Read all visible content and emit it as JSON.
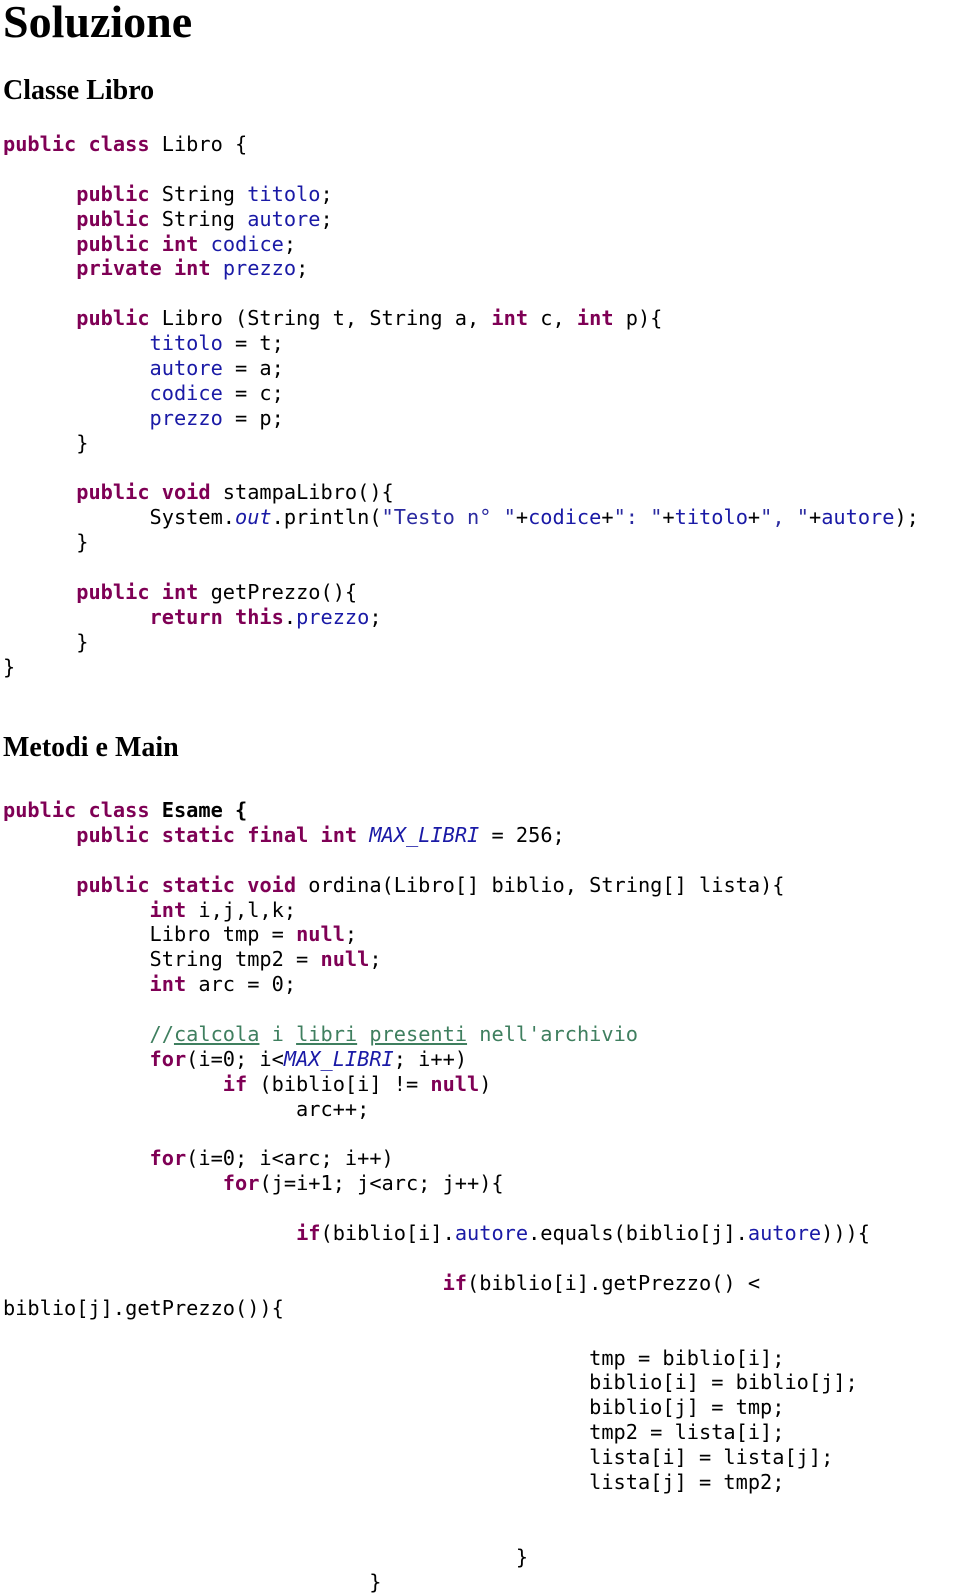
{
  "title": "Soluzione",
  "sections": [
    {
      "heading": "Classe Libro",
      "lines": [
        [
          [
            "kw",
            "public"
          ],
          [
            "t",
            " "
          ],
          [
            "kw",
            "class"
          ],
          [
            "t",
            " Libro {"
          ]
        ],
        [
          [
            "t",
            ""
          ]
        ],
        [
          [
            "t",
            "      "
          ],
          [
            "kw",
            "public"
          ],
          [
            "t",
            " String "
          ],
          [
            "fld",
            "titolo"
          ],
          [
            "t",
            ";"
          ]
        ],
        [
          [
            "t",
            "      "
          ],
          [
            "kw",
            "public"
          ],
          [
            "t",
            " String "
          ],
          [
            "fld",
            "autore"
          ],
          [
            "t",
            ";"
          ]
        ],
        [
          [
            "t",
            "      "
          ],
          [
            "kw",
            "public"
          ],
          [
            "t",
            " "
          ],
          [
            "kw",
            "int"
          ],
          [
            "t",
            " "
          ],
          [
            "fld",
            "codice"
          ],
          [
            "t",
            ";"
          ]
        ],
        [
          [
            "t",
            "      "
          ],
          [
            "kw",
            "private"
          ],
          [
            "t",
            " "
          ],
          [
            "kw",
            "int"
          ],
          [
            "t",
            " "
          ],
          [
            "fld",
            "prezzo"
          ],
          [
            "t",
            ";"
          ]
        ],
        [
          [
            "t",
            ""
          ]
        ],
        [
          [
            "t",
            "      "
          ],
          [
            "kw",
            "public"
          ],
          [
            "t",
            " Libro (String t, String a, "
          ],
          [
            "kw",
            "int"
          ],
          [
            "t",
            " c, "
          ],
          [
            "kw",
            "int"
          ],
          [
            "t",
            " p){"
          ]
        ],
        [
          [
            "t",
            "            "
          ],
          [
            "fld",
            "titolo"
          ],
          [
            "t",
            " = t;"
          ]
        ],
        [
          [
            "t",
            "            "
          ],
          [
            "fld",
            "autore"
          ],
          [
            "t",
            " = a;"
          ]
        ],
        [
          [
            "t",
            "            "
          ],
          [
            "fld",
            "codice"
          ],
          [
            "t",
            " = c;"
          ]
        ],
        [
          [
            "t",
            "            "
          ],
          [
            "fld",
            "prezzo"
          ],
          [
            "t",
            " = p;"
          ]
        ],
        [
          [
            "t",
            "      }"
          ]
        ],
        [
          [
            "t",
            ""
          ]
        ],
        [
          [
            "t",
            "      "
          ],
          [
            "kw",
            "public"
          ],
          [
            "t",
            " "
          ],
          [
            "kw",
            "void"
          ],
          [
            "t",
            " stampaLibro(){"
          ]
        ],
        [
          [
            "t",
            "            System."
          ],
          [
            "sfld",
            "out"
          ],
          [
            "t",
            ".println("
          ],
          [
            "str",
            "\"Testo n° \""
          ],
          [
            "t",
            "+"
          ],
          [
            "fld",
            "codice"
          ],
          [
            "t",
            "+"
          ],
          [
            "str",
            "\": \""
          ],
          [
            "t",
            "+"
          ],
          [
            "fld",
            "titolo"
          ],
          [
            "t",
            "+"
          ],
          [
            "str",
            "\", \""
          ],
          [
            "t",
            "+"
          ],
          [
            "fld",
            "autore"
          ],
          [
            "t",
            ");"
          ]
        ],
        [
          [
            "t",
            "      }"
          ]
        ],
        [
          [
            "t",
            ""
          ]
        ],
        [
          [
            "t",
            "      "
          ],
          [
            "kw",
            "public"
          ],
          [
            "t",
            " "
          ],
          [
            "kw",
            "int"
          ],
          [
            "t",
            " getPrezzo(){"
          ]
        ],
        [
          [
            "t",
            "            "
          ],
          [
            "kw",
            "return"
          ],
          [
            "t",
            " "
          ],
          [
            "kw",
            "this"
          ],
          [
            "t",
            "."
          ],
          [
            "fld",
            "prezzo"
          ],
          [
            "t",
            ";"
          ]
        ],
        [
          [
            "t",
            "      }"
          ]
        ],
        [
          [
            "t",
            "}"
          ]
        ]
      ]
    },
    {
      "heading": "Metodi e Main",
      "lines": [
        [
          [
            "kw",
            "public"
          ],
          [
            "t",
            " "
          ],
          [
            "kw",
            "class"
          ],
          [
            "t",
            " "
          ],
          [
            "bold",
            "Esame {"
          ]
        ],
        [
          [
            "t",
            "      "
          ],
          [
            "kw",
            "public"
          ],
          [
            "t",
            " "
          ],
          [
            "kw",
            "static"
          ],
          [
            "t",
            " "
          ],
          [
            "kw",
            "final"
          ],
          [
            "t",
            " "
          ],
          [
            "kw",
            "int"
          ],
          [
            "t",
            " "
          ],
          [
            "sfld",
            "MAX_LIBRI"
          ],
          [
            "t",
            " = 256;"
          ]
        ],
        [
          [
            "t",
            ""
          ]
        ],
        [
          [
            "t",
            "      "
          ],
          [
            "kw",
            "public"
          ],
          [
            "t",
            " "
          ],
          [
            "kw",
            "static"
          ],
          [
            "t",
            " "
          ],
          [
            "kw",
            "void"
          ],
          [
            "t",
            " ordina(Libro[] biblio, String[] lista){"
          ]
        ],
        [
          [
            "t",
            "            "
          ],
          [
            "kw",
            "int"
          ],
          [
            "t",
            " i,j,l,k;"
          ]
        ],
        [
          [
            "t",
            "            Libro tmp = "
          ],
          [
            "kw",
            "null"
          ],
          [
            "t",
            ";"
          ]
        ],
        [
          [
            "t",
            "            String tmp2 = "
          ],
          [
            "kw",
            "null"
          ],
          [
            "t",
            ";"
          ]
        ],
        [
          [
            "t",
            "            "
          ],
          [
            "kw",
            "int"
          ],
          [
            "t",
            " arc = 0;"
          ]
        ],
        [
          [
            "t",
            ""
          ]
        ],
        [
          [
            "t",
            "            "
          ],
          [
            "cm",
            "//"
          ],
          [
            "cmu",
            "calcola"
          ],
          [
            "cm",
            " i "
          ],
          [
            "cmu",
            "libri"
          ],
          [
            "cm",
            " "
          ],
          [
            "cmu",
            "presenti"
          ],
          [
            "cm",
            " nell'archivio"
          ]
        ],
        [
          [
            "t",
            "            "
          ],
          [
            "kw",
            "for"
          ],
          [
            "t",
            "(i=0; i<"
          ],
          [
            "sfld",
            "MAX_LIBRI"
          ],
          [
            "t",
            "; i++)"
          ]
        ],
        [
          [
            "t",
            "                  "
          ],
          [
            "kw",
            "if"
          ],
          [
            "t",
            " (biblio[i] != "
          ],
          [
            "kw",
            "null"
          ],
          [
            "t",
            ")"
          ]
        ],
        [
          [
            "t",
            "                        arc++;"
          ]
        ],
        [
          [
            "t",
            ""
          ]
        ],
        [
          [
            "t",
            "            "
          ],
          [
            "kw",
            "for"
          ],
          [
            "t",
            "(i=0; i<arc; i++)"
          ]
        ],
        [
          [
            "t",
            "                  "
          ],
          [
            "kw",
            "for"
          ],
          [
            "t",
            "(j=i+1; j<arc; j++){"
          ]
        ],
        [
          [
            "t",
            ""
          ]
        ],
        [
          [
            "t",
            "                        "
          ],
          [
            "kw",
            "if"
          ],
          [
            "t",
            "(biblio[i]."
          ],
          [
            "fld",
            "autore"
          ],
          [
            "t",
            ".equals(biblio[j]."
          ],
          [
            "fld",
            "autore"
          ],
          [
            "t",
            "))){"
          ]
        ],
        [
          [
            "t",
            ""
          ]
        ],
        [
          [
            "t",
            "                                    "
          ],
          [
            "kw",
            "if"
          ],
          [
            "t",
            "(biblio[i].getPrezzo() <"
          ]
        ],
        [
          [
            "t",
            "biblio[j].getPrezzo()){"
          ]
        ],
        [
          [
            "t",
            ""
          ]
        ],
        [
          [
            "t",
            "                                                "
          ],
          [
            "t",
            "tmp = biblio[i];"
          ]
        ],
        [
          [
            "t",
            "                                                "
          ],
          [
            "t",
            "biblio[i] = biblio[j];"
          ]
        ],
        [
          [
            "t",
            "                                                "
          ],
          [
            "t",
            "biblio[j] = tmp;"
          ]
        ],
        [
          [
            "t",
            "                                                "
          ],
          [
            "t",
            "tmp2 = lista[i];"
          ]
        ],
        [
          [
            "t",
            "                                                "
          ],
          [
            "t",
            "lista[i] = lista[j];"
          ]
        ],
        [
          [
            "t",
            "                                                "
          ],
          [
            "t",
            "lista[j] = tmp2;"
          ]
        ],
        [
          [
            "t",
            ""
          ]
        ],
        [
          [
            "t",
            ""
          ]
        ],
        [
          [
            "t",
            "                                          }"
          ]
        ],
        [
          [
            "t",
            "                              }"
          ]
        ]
      ]
    }
  ]
}
